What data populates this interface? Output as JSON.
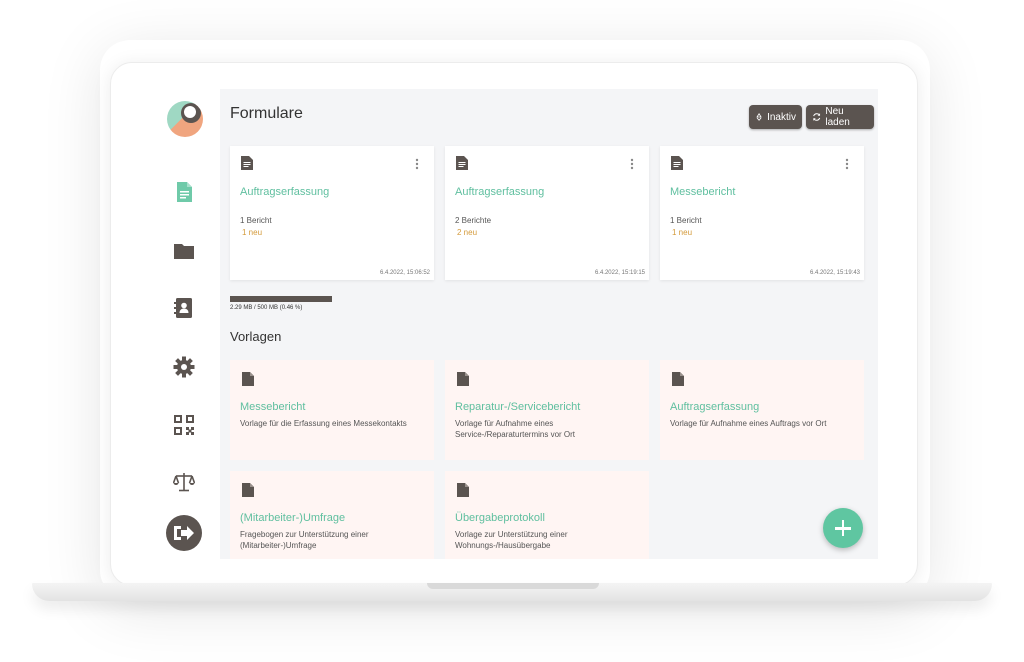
{
  "page_title": "Formulare",
  "buttons": {
    "inactive_label": "Inaktiv",
    "reload_label": "Neu laden"
  },
  "forms": [
    {
      "name": "Auftragserfassung",
      "count": "1 Bericht",
      "new": "1 neu",
      "timestamp": "6.4.2022, 15:06:52"
    },
    {
      "name": "Auftragserfassung",
      "count": "2 Berichte",
      "new": "2 neu",
      "timestamp": "6.4.2022, 15:19:15"
    },
    {
      "name": "Messebericht",
      "count": "1 Bericht",
      "new": "1 neu",
      "timestamp": "6.4.2022, 15:19:43"
    }
  ],
  "storage": {
    "label": "2.29 MB / 500 MB (0.46 %)",
    "percent": 0.46
  },
  "templates_title": "Vorlagen",
  "templates": [
    {
      "name": "Messebericht",
      "description": "Vorlage für die Erfassung eines Messekontakts"
    },
    {
      "name": "Reparatur-/Servicebericht",
      "description": "Vorlage für Aufnahme eines Service-/Reparaturtermins vor Ort"
    },
    {
      "name": "Auftragserfassung",
      "description": "Vorlage für Aufnahme eines Auftrags vor Ort"
    },
    {
      "name": "(Mitarbeiter-)Umfrage",
      "description": "Fragebogen zur Unterstützung einer (Mitarbeiter-)Umfrage"
    },
    {
      "name": "Übergabeprotokoll",
      "description": "Vorlage zur Unterstützung einer Wohnungs-/Hausübergabe"
    }
  ],
  "colors": {
    "accent": "#5fbf9f",
    "dark": "#5b5450",
    "new_badge": "#d49a3a",
    "template_bg": "#fff5f3"
  },
  "sidebar_icons": [
    "document-icon",
    "folder-icon",
    "contacts-icon",
    "gear-icon",
    "qr-code-icon",
    "scale-icon"
  ]
}
